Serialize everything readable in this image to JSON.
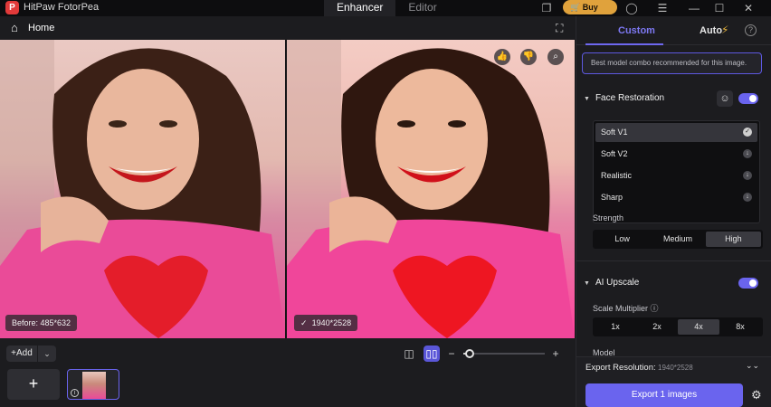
{
  "app": {
    "logo": "P",
    "title": "HitPaw FotorPea"
  },
  "tabs": [
    {
      "label": "Enhancer",
      "active": true
    },
    {
      "label": "Editor",
      "active": false
    }
  ],
  "titlebar": {
    "buy_label": "Buy Now"
  },
  "homebar": {
    "label": "Home"
  },
  "before": {
    "badge": "Before: 485*632"
  },
  "after": {
    "badge": "1940*2528"
  },
  "bottom": {
    "add_label": "Add"
  },
  "panel": {
    "tabs": {
      "custom": "Custom",
      "auto": "Auto"
    },
    "recommend": "Best model combo recommended for this image.",
    "face_restoration": {
      "title": "Face Restoration",
      "enabled": true,
      "models": [
        {
          "label": "Soft V1",
          "selected": true
        },
        {
          "label": "Soft V2",
          "selected": false
        },
        {
          "label": "Realistic",
          "selected": false
        },
        {
          "label": "Sharp",
          "selected": false
        }
      ],
      "strength_label": "Strength",
      "strength_options": [
        "Low",
        "Medium",
        "High"
      ],
      "strength_selected": "High"
    },
    "ai_upscale": {
      "title": "AI Upscale",
      "enabled": true,
      "scale_label": "Scale Multiplier",
      "scale_options": [
        "1x",
        "2x",
        "4x",
        "8x"
      ],
      "scale_selected": "4x"
    },
    "model_label": "Model",
    "export": {
      "resolution_label": "Export Resolution:",
      "resolution_value": "1940*2528",
      "button": "Export 1 images"
    }
  },
  "colors": {
    "accent": "#6a64ee",
    "buy": "#e0a23c",
    "background": "#1c1c1f"
  }
}
